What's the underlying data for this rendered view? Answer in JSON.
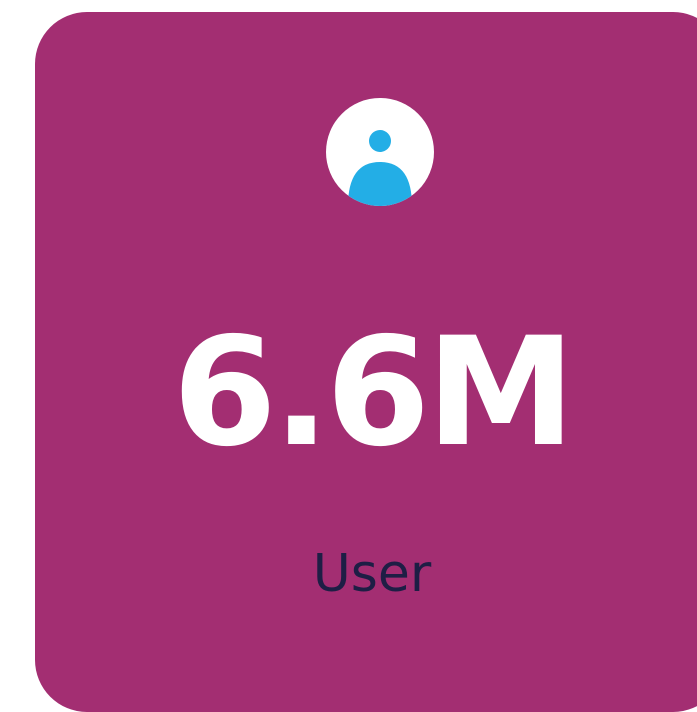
{
  "card": {
    "value": "6.6M",
    "label": "User",
    "icon": "user-icon",
    "colors": {
      "background": "#A32E72",
      "value_text": "#FFFFFF",
      "label_text": "#1E1E45",
      "icon_accent": "#23AEE6",
      "icon_background": "#FFFFFF"
    }
  }
}
